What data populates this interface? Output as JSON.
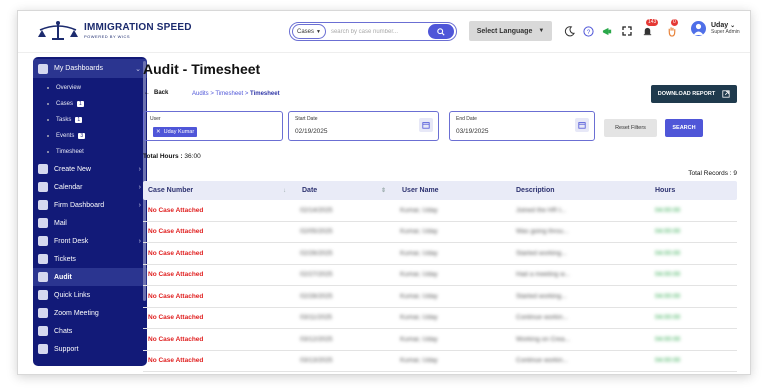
{
  "brand": {
    "name": "IMMIGRATION SPEED",
    "tagline": "POWERED BY WICS"
  },
  "topbar": {
    "search_select": "Cases",
    "search_placeholder": "search by case number...",
    "language_label": "Select Language",
    "notifications_count": "143",
    "alerts_count": "0",
    "user_name": "Uday",
    "user_role": "Super Admin"
  },
  "sidebar": {
    "dashboards_label": "My Dashboards",
    "sub_items": [
      {
        "label": "Overview",
        "count": ""
      },
      {
        "label": "Cases",
        "count": "1"
      },
      {
        "label": "Tasks",
        "count": "1"
      },
      {
        "label": "Events",
        "count": "3"
      },
      {
        "label": "Timesheet",
        "count": ""
      }
    ],
    "items": [
      {
        "label": "Create New",
        "icon": "plus-square-icon"
      },
      {
        "label": "Calendar",
        "icon": "calendar-icon"
      },
      {
        "label": "Firm Dashboard",
        "icon": "lock-icon"
      },
      {
        "label": "Mail",
        "icon": "mail-icon"
      },
      {
        "label": "Front Desk",
        "icon": "desk-icon"
      },
      {
        "label": "Tickets",
        "icon": "ticket-icon"
      },
      {
        "label": "Audit",
        "icon": "audit-icon"
      },
      {
        "label": "Quick Links",
        "icon": "link-icon"
      },
      {
        "label": "Zoom Meeting",
        "icon": "video-icon"
      },
      {
        "label": "Chats",
        "icon": "chat-icon"
      },
      {
        "label": "Support",
        "icon": "headset-icon"
      }
    ]
  },
  "page": {
    "title": "Audit - Timesheet",
    "back_label": "Back",
    "breadcrumb_prefix": "Audits > Timesheet > ",
    "breadcrumb_current": "Timesheet",
    "download_label": "DOWNLOAD REPORT"
  },
  "filters": {
    "user_label": "User",
    "user_chip": "Uday Kumar",
    "start_label": "Start Date",
    "start_value": "02/19/2025",
    "end_label": "End Date",
    "end_value": "03/19/2025",
    "reset_label": "Reset Filters",
    "search_label": "SEARCH"
  },
  "summary": {
    "total_hours_label": "Total Hours :",
    "total_hours_value": " 36:00",
    "total_records": "Total Records : 9"
  },
  "table": {
    "headers": [
      "Case Number",
      "Date",
      "User Name",
      "Description",
      "Hours"
    ],
    "rows": [
      {
        "case": "No Case Attached",
        "date": "02/14/2025",
        "user": "Kumar, Uday",
        "desc": "Joined the HR t...",
        "hours": "04:00:00"
      },
      {
        "case": "No Case Attached",
        "date": "02/05/2025",
        "user": "Kumar, Uday",
        "desc": "Was going throu...",
        "hours": "04:00:00"
      },
      {
        "case": "No Case Attached",
        "date": "02/26/2025",
        "user": "Kumar, Uday",
        "desc": "Started working...",
        "hours": "04:00:00"
      },
      {
        "case": "No Case Attached",
        "date": "02/27/2025",
        "user": "Kumar, Uday",
        "desc": "Had a meeting w...",
        "hours": "04:00:00"
      },
      {
        "case": "No Case Attached",
        "date": "02/28/2025",
        "user": "Kumar, Uday",
        "desc": "Started working...",
        "hours": "04:00:00"
      },
      {
        "case": "No Case Attached",
        "date": "03/11/2025",
        "user": "Kumar, Uday",
        "desc": "Continue workin...",
        "hours": "04:00:00"
      },
      {
        "case": "No Case Attached",
        "date": "03/12/2025",
        "user": "Kumar, Uday",
        "desc": "Working on Crea...",
        "hours": "04:00:00"
      },
      {
        "case": "No Case Attached",
        "date": "03/13/2025",
        "user": "Kumar, Uday",
        "desc": "Continue workin...",
        "hours": "04:00:00"
      }
    ]
  },
  "colors": {
    "sidebar_bg": "#121a78",
    "accent": "#4f56d8",
    "no_case_red": "#e02020",
    "hours_green": "#2aa84a",
    "download_bg": "#1f3a4d"
  }
}
